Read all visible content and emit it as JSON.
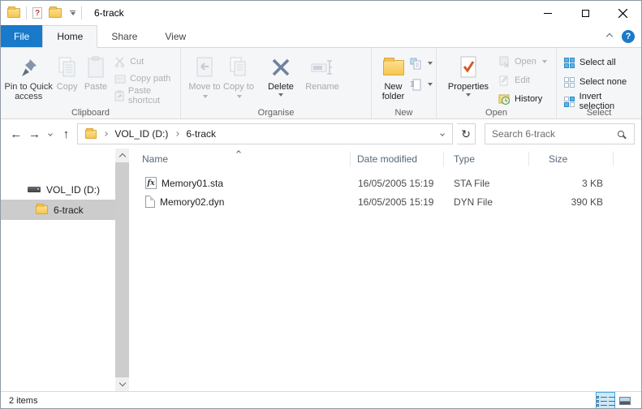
{
  "window": {
    "title": "6-track"
  },
  "tabs": {
    "file": "File",
    "home": "Home",
    "share": "Share",
    "view": "View"
  },
  "ribbon": {
    "clipboard": {
      "label": "Clipboard",
      "pin_to_quick_access": "Pin to Quick access",
      "copy": "Copy",
      "paste": "Paste",
      "cut": "Cut",
      "copy_path": "Copy path",
      "paste_shortcut": "Paste shortcut"
    },
    "organise": {
      "label": "Organise",
      "move_to": "Move to",
      "copy_to": "Copy to",
      "delete": "Delete",
      "rename": "Rename"
    },
    "new_group": {
      "label": "New",
      "new_folder": "New folder"
    },
    "open_group": {
      "label": "Open",
      "properties": "Properties",
      "open": "Open",
      "edit": "Edit",
      "history": "History"
    },
    "select_group": {
      "label": "Select",
      "select_all": "Select all",
      "select_none": "Select none",
      "invert_selection": "Invert selection"
    }
  },
  "address_bar": {
    "path_segments": [
      "VOL_ID (D:)",
      "6-track"
    ],
    "search_placeholder": "Search 6-track"
  },
  "sidebar": {
    "items": [
      {
        "label": "VOL_ID (D:)"
      },
      {
        "label": "6-track"
      }
    ]
  },
  "file_list": {
    "columns": [
      "Name",
      "Date modified",
      "Type",
      "Size"
    ],
    "rows": [
      {
        "name": "Memory01.sta",
        "date_modified": "16/05/2005 15:19",
        "type": "STA File",
        "size": "3 KB"
      },
      {
        "name": "Memory02.dyn",
        "date_modified": "16/05/2005 15:19",
        "type": "DYN File",
        "size": "390 KB"
      }
    ]
  },
  "status_bar": {
    "items_count": "2 items"
  },
  "icons_text": {
    "back_arrow": "←",
    "forward_arrow": "→",
    "up_arrow": "↑",
    "refresh": "↻",
    "fx_badge": "fx",
    "help": "?"
  },
  "colors": {
    "accent_blue": "#1979ca",
    "selection_grey": "#cccccc",
    "select_icon_blue": "#59b4e8"
  }
}
